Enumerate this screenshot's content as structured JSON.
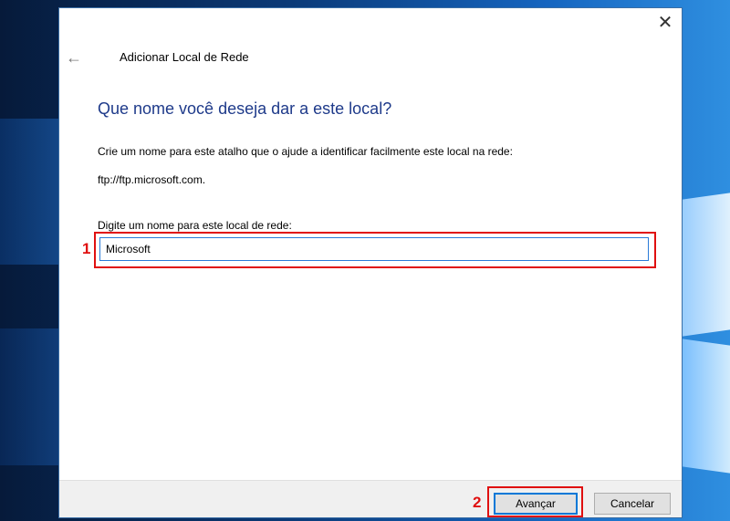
{
  "window": {
    "title": "Adicionar Local de Rede",
    "close_icon": "close-icon",
    "back_icon": "back-arrow-icon"
  },
  "page": {
    "heading": "Que nome você deseja dar a este local?",
    "description": "Crie um nome para este atalho que o ajude a identificar facilmente este local na rede:",
    "address": "ftp://ftp.microsoft.com.",
    "field_label": "Digite um nome para este local de rede:",
    "name_value": "Microsoft"
  },
  "annotations": {
    "step1": "1",
    "step2": "2",
    "highlight_color": "#e01010"
  },
  "footer": {
    "next_label": "Avançar",
    "cancel_label": "Cancelar"
  },
  "colors": {
    "heading": "#1e3a8a",
    "focus_border": "#0078d7"
  }
}
